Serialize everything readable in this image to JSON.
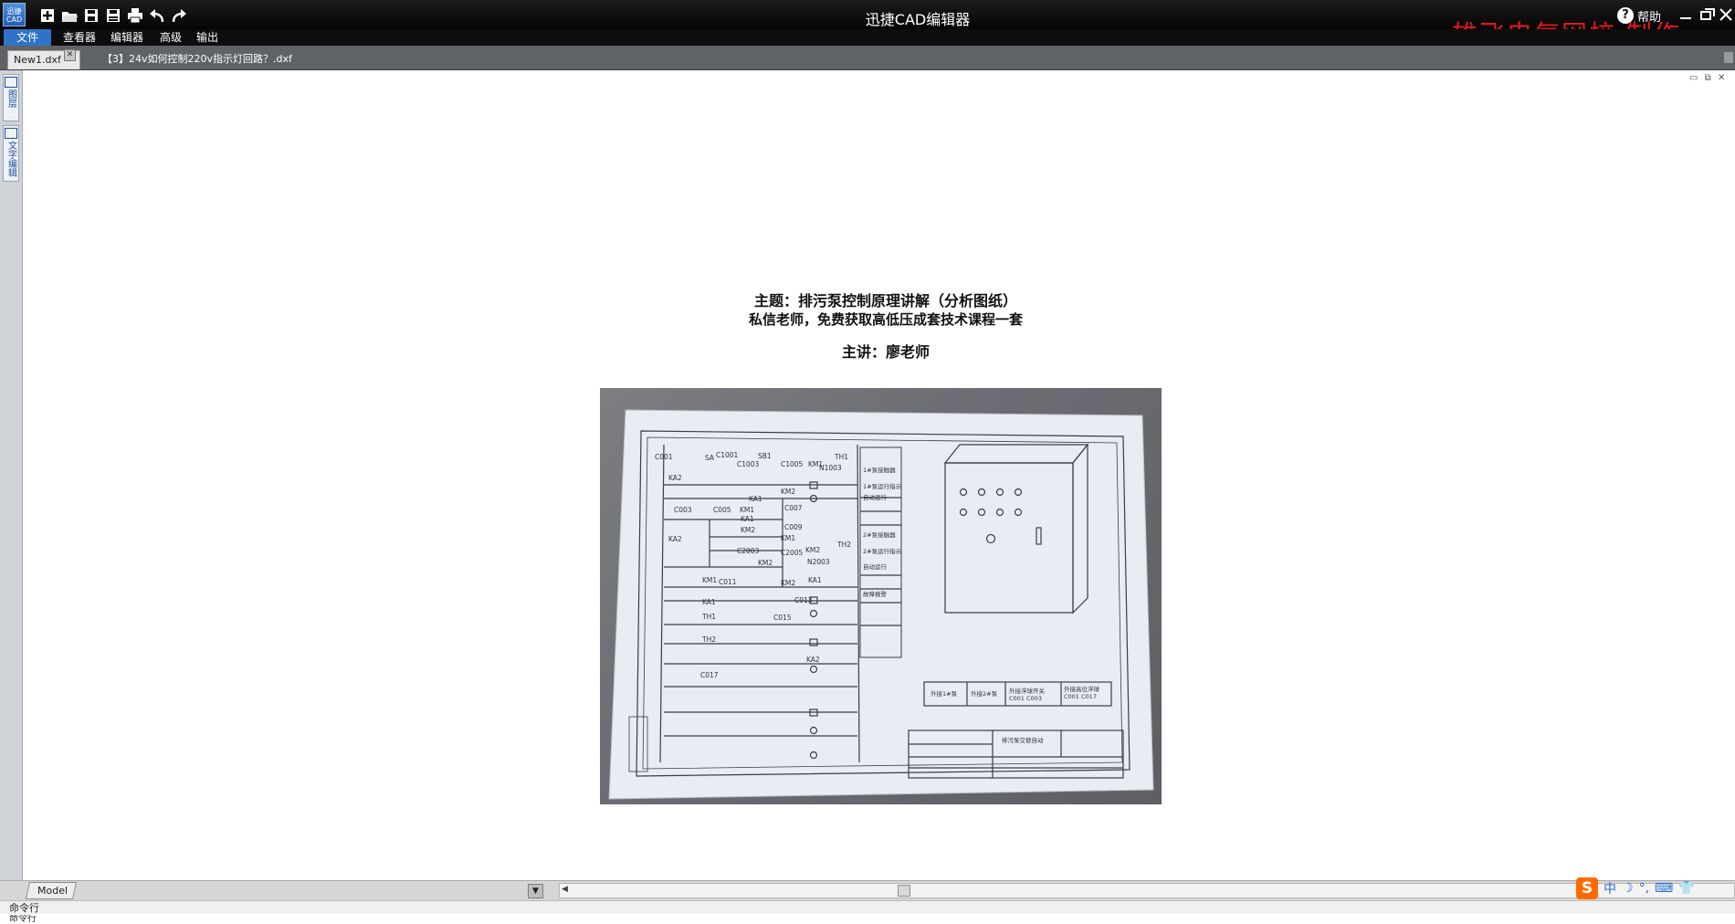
{
  "app": {
    "title": "迅捷CAD编辑器",
    "logo_text": "迅捷\nCAD",
    "help_label": "帮助",
    "watermark": "雄飞电气网校  制作",
    "accent": "#2e73c8"
  },
  "quick_access": [
    "new-icon",
    "open-icon",
    "save-icon",
    "save-as-icon",
    "print-icon",
    "undo-icon",
    "redo-icon"
  ],
  "menu": {
    "file": "文件",
    "viewer": "查看器",
    "editor": "编辑器",
    "advanced": "高级",
    "output": "输出"
  },
  "tabs": {
    "active": "New1.dxf",
    "second": "【3】24v如何控制220v指示灯回路？.dxf"
  },
  "left_panel": {
    "btn1": "图层",
    "btn2": "文字编辑"
  },
  "drawing": {
    "caption_title": "主题：排污泵控制原理讲解（分析图纸）",
    "caption_sub": "私信老师，免费获取高低压成套技术课程一套",
    "caption_teacher": "主讲：廖老师",
    "photo": {
      "labels": {
        "sa": "SA",
        "sb1": "SB1",
        "km1_top": "KM1",
        "th1": "TH1",
        "c001": "C001",
        "c1001": "C1001",
        "c1003": "C1003",
        "c1005": "C1005",
        "n1003": "N1003",
        "ka2_a": "KA2",
        "ka1_a": "KA1",
        "km2_a": "KM2",
        "c003": "C003",
        "c005": "C005",
        "km1_b": "KM1",
        "c007": "C007",
        "ka1_b": "KA1",
        "km2_b": "KM2",
        "c009": "C009",
        "km1_c": "KM1",
        "ka2_b": "KA2",
        "c2003": "C2003",
        "c2005": "C2005",
        "km2_c": "KM2",
        "th2": "TH2",
        "n2003": "N2003",
        "km2_d": "KM2",
        "km1_d": "KM1",
        "c011": "C011",
        "km2_e": "KM2",
        "ka1_c": "KA1",
        "c013": "C013",
        "ka1_d": "KA1",
        "th1_b": "TH1",
        "c015": "C015",
        "th2_b": "TH2",
        "ka2_c": "KA2",
        "c017": "C017",
        "col1": "1#泵接触器",
        "col2": "1#泵运行指示",
        "col3": "自动运行",
        "col4": "2#泵接触器",
        "col5": "2#泵运行指示",
        "col6": "自动运行",
        "col7": "故障报警",
        "bt1": "外接1#泵",
        "bt2": "外接2#泵",
        "bt3": "外接浮球开关\nC001  C003",
        "bt4": "外接高位浮球\nC001  C017",
        "tb_title": "排污泵交替自动"
      }
    }
  },
  "bottom": {
    "model_tab": "Model",
    "ime": [
      "中",
      "☽",
      "°,",
      "⌨",
      "👕"
    ],
    "cmd_label": "命令行",
    "cmd_prompt": "命令行"
  }
}
